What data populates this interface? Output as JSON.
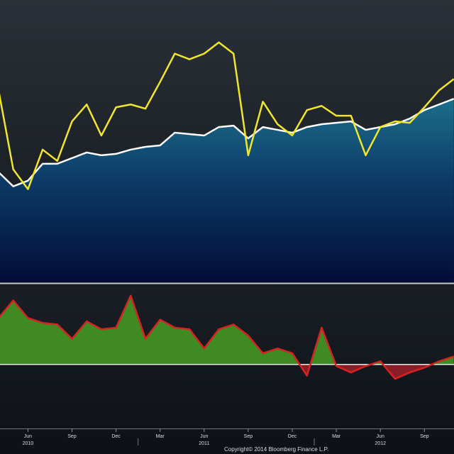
{
  "chart_data": [
    {
      "type": "area",
      "title": "",
      "xlabel": "",
      "ylabel": "",
      "x": [
        "2010-04",
        "2010-05",
        "2010-06",
        "2010-07",
        "2010-08",
        "2010-09",
        "2010-10",
        "2010-11",
        "2010-12",
        "2011-01",
        "2011-02",
        "2011-03",
        "2011-04",
        "2011-05",
        "2011-06",
        "2011-07",
        "2011-08",
        "2011-09",
        "2011-10",
        "2011-11",
        "2011-12",
        "2012-01",
        "2012-02",
        "2012-03",
        "2012-04",
        "2012-05",
        "2012-06",
        "2012-07",
        "2012-08",
        "2012-09",
        "2012-10",
        "2012-11"
      ],
      "series": [
        {
          "values": [
            104,
            99,
            101,
            107,
            107,
            109,
            111,
            110,
            110.5,
            112,
            113,
            113.5,
            118,
            117.5,
            117,
            120,
            120.5,
            116,
            120,
            119,
            118,
            120,
            121,
            121.5,
            122,
            119,
            120,
            121,
            123,
            126,
            128,
            130
          ],
          "color": "#ffffff",
          "fill": "area"
        },
        {
          "values": [
            133,
            105,
            98,
            112,
            108,
            122,
            128,
            117,
            127,
            128,
            126.5,
            136,
            146,
            144,
            146,
            150,
            146,
            110,
            129,
            121,
            117,
            126,
            127.5,
            124,
            124,
            110,
            120,
            122,
            121.5,
            127,
            133,
            137
          ],
          "color": "#f0e62a"
        }
      ],
      "ylim": [
        65,
        165
      ],
      "grid": false
    },
    {
      "type": "area",
      "x": [
        "2010-04",
        "2010-05",
        "2010-06",
        "2010-07",
        "2010-08",
        "2010-09",
        "2010-10",
        "2010-11",
        "2010-12",
        "2011-01",
        "2011-02",
        "2011-03",
        "2011-04",
        "2011-05",
        "2011-06",
        "2011-07",
        "2011-08",
        "2011-09",
        "2011-10",
        "2011-11",
        "2011-12",
        "2012-01",
        "2012-02",
        "2012-03",
        "2012-04",
        "2012-05",
        "2012-06",
        "2012-07",
        "2012-08",
        "2012-09",
        "2012-10",
        "2012-11"
      ],
      "series": [
        {
          "values": [
            29,
            40,
            29,
            26,
            25,
            16,
            27,
            22,
            23,
            43,
            16,
            28,
            23,
            22,
            10,
            22,
            25,
            18,
            7,
            10,
            7,
            -7,
            23,
            -1,
            -5,
            -1,
            2,
            -9,
            -5,
            -2,
            2,
            5
          ],
          "color": "#d62222",
          "positive_fill": "#3f8a22",
          "negative_fill": "#8a1e26"
        }
      ],
      "ylim": [
        -40,
        50
      ],
      "baseline": 0
    }
  ],
  "axis": {
    "months": [
      "Jun",
      "Sep",
      "Dec",
      "Mar",
      "Jun",
      "Sep",
      "Dec",
      "Mar",
      "Jun",
      "Sep"
    ],
    "years": [
      "2010",
      "2011",
      "2012"
    ]
  },
  "copyright": "Copyright© 2014 Bloomberg Finance L.P."
}
